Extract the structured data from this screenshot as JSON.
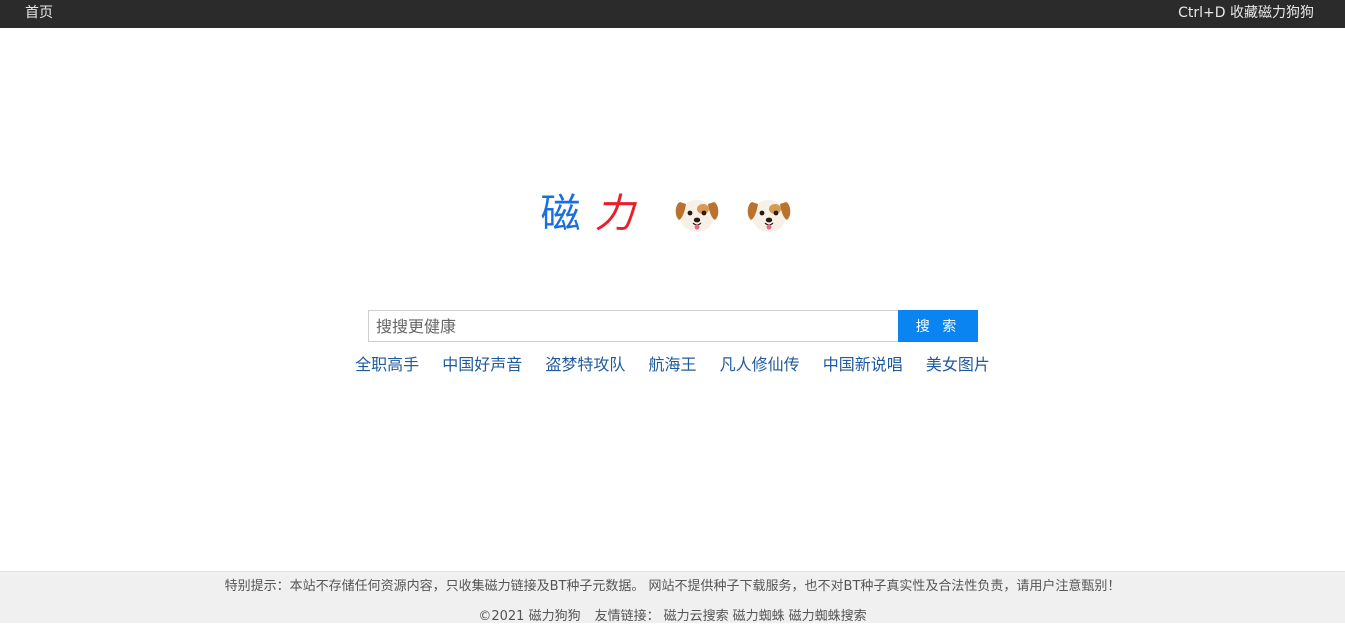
{
  "topbar": {
    "home_label": "首页",
    "bookmark_hint": "Ctrl+D 收藏磁力狗狗"
  },
  "logo": {
    "char1": "磁",
    "char2": "力",
    "icon_1": "dog-face-icon",
    "icon_2": "dog-face-icon",
    "colors": {
      "char1": "#1a6fe0",
      "char2": "#e8202a"
    }
  },
  "search": {
    "placeholder": "搜搜更健康",
    "value": "",
    "button_label": "搜 索",
    "button_color": "#0a84f0"
  },
  "hotwords": [
    "全职高手",
    "中国好声音",
    "盗梦特攻队",
    "航海王",
    "凡人修仙传",
    "中国新说唱",
    "美女图片"
  ],
  "footer": {
    "notice": "特别提示：本站不存储任何资源内容，只收集磁力链接及BT种子元数据。 网站不提供种子下载服务，也不对BT种子真实性及合法性负责，请用户注意甄别！",
    "copyright": "©2021 磁力狗狗",
    "links_label": "友情链接：",
    "links": [
      "磁力云搜索",
      "磁力蜘蛛",
      "磁力蜘蛛搜索"
    ]
  }
}
